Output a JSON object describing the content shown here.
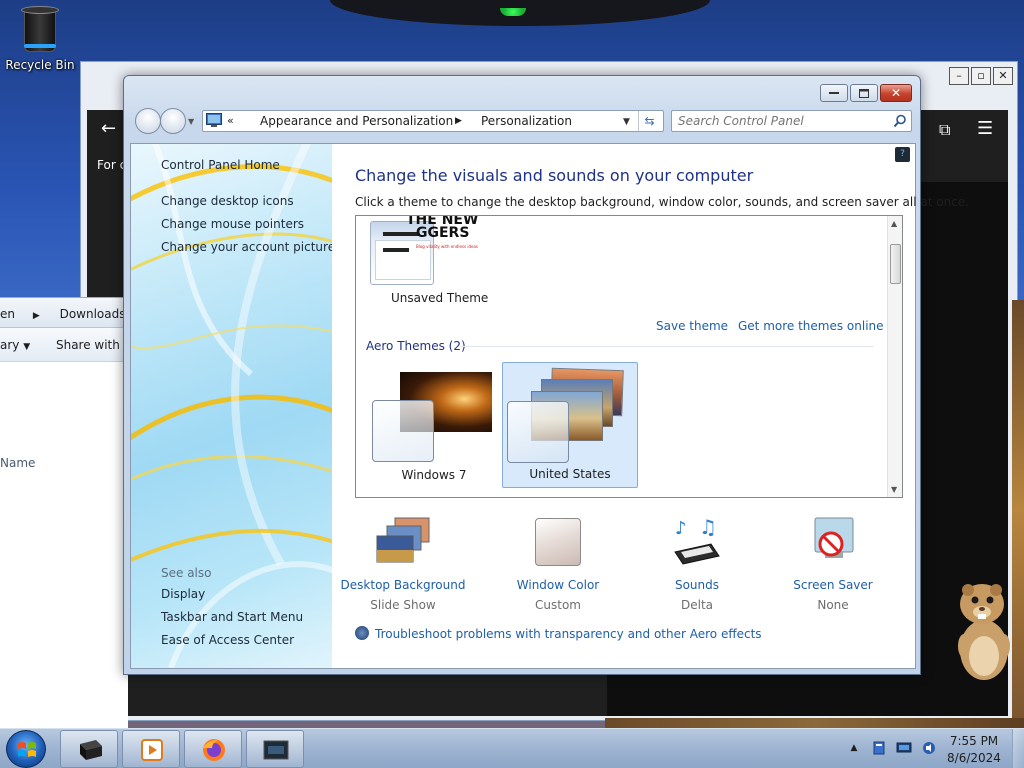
{
  "desktop": {
    "recycle_bin_label": "Recycle Bin"
  },
  "background_app": {
    "left_text": "For c"
  },
  "explorer": {
    "crumb_prefix": "en",
    "crumb": "Downloads",
    "cmd_library": "ary",
    "cmd_share": "Share with",
    "col_name": "Name"
  },
  "window": {
    "breadcrumb": [
      "Appearance and Personalization",
      "Personalization"
    ],
    "breadcrumb_overflow": "«",
    "search_placeholder": "Search Control Panel"
  },
  "left_pane": {
    "home": "Control Panel Home",
    "links": [
      "Change desktop icons",
      "Change mouse pointers",
      "Change your account picture"
    ],
    "see_also_label": "See also",
    "see_also": [
      "Display",
      "Taskbar and Start Menu",
      "Ease of Access Center"
    ]
  },
  "main": {
    "help_icon": "?",
    "title": "Change the visuals and sounds on your computer",
    "subtitle": "Click a theme to change the desktop background, window color, sounds, and screen saver all at once.",
    "unsaved_theme_label": "Unsaved Theme",
    "unsaved_theme_caption": [
      "THE NEW",
      "GGERS",
      "Blog vitality with endless ideas"
    ],
    "save_theme": "Save theme",
    "get_more": "Get more themes online",
    "group_header": "Aero Themes (2)",
    "themes": [
      {
        "label": "Windows 7",
        "selected": false
      },
      {
        "label": "United States",
        "selected": true
      }
    ],
    "items": [
      {
        "title": "Desktop Background",
        "value": "Slide Show",
        "icon": "desktop-background-icon"
      },
      {
        "title": "Window Color",
        "value": "Custom",
        "icon": "window-color-icon"
      },
      {
        "title": "Sounds",
        "value": "Delta",
        "icon": "sounds-icon"
      },
      {
        "title": "Screen Saver",
        "value": "None",
        "icon": "screen-saver-icon"
      }
    ],
    "troubleshoot": "Troubleshoot problems with transparency and other Aero effects"
  },
  "taskbar": {
    "time": "7:55 PM",
    "date": "8/6/2024"
  },
  "colors": {
    "link": "#1e5fa8",
    "heading": "#1e3287",
    "selection": "#d8e9fb",
    "close": "#c7432e"
  }
}
